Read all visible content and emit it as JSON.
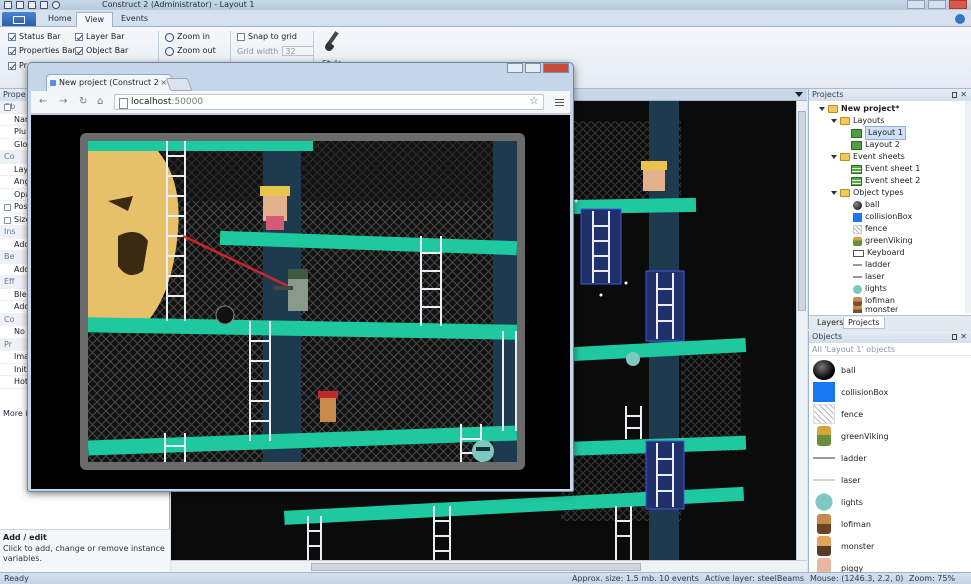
{
  "window": {
    "title": "Construct 2 (Administrator) - Layout 1"
  },
  "ribbon": {
    "tabs": [
      "Home",
      "View",
      "Events"
    ],
    "active_tab": "View",
    "view": {
      "status_bar": "Status Bar",
      "properties_bar": "Properties Bar",
      "project_bar_partial": "Pr",
      "layer_bar": "Layer Bar",
      "object_bar": "Object Bar",
      "zoom_in": "Zoom in",
      "zoom_out": "Zoom out",
      "snap_to_grid": "Snap to grid",
      "grid_width_label": "Grid width",
      "grid_width_value": "32",
      "style": "Style"
    }
  },
  "properties": {
    "title": "Prope",
    "rows": [
      "Ob",
      "Nam",
      "Plu",
      "Glo",
      "Co",
      "Lay",
      "Ang",
      "Opa",
      "Pos",
      "Size",
      "Ins",
      "Add",
      "Be",
      "Add",
      "Eff",
      "Blen",
      "Add",
      "Co",
      "No",
      "Pr",
      "Ima",
      "Init",
      "Hot"
    ],
    "more_info": "More in",
    "help_title": "Add / edit",
    "help_desc": "Click to add, change or remove instance variables."
  },
  "browser": {
    "tab_title": "New project (Construct 2",
    "tab_close": "×",
    "url_host": "localhost",
    "url_port": ":50000"
  },
  "projects": {
    "title": "Projects",
    "root": "New project*",
    "layouts_folder": "Layouts",
    "layouts": [
      "Layout 1",
      "Layout 2"
    ],
    "event_sheets_folder": "Event sheets",
    "event_sheets": [
      "Event sheet 1",
      "Event sheet 2"
    ],
    "object_types_folder": "Object types",
    "object_types": [
      {
        "name": "ball",
        "icon": "ball-icon"
      },
      {
        "name": "collisionBox",
        "icon": "collision-box-icon"
      },
      {
        "name": "fence",
        "icon": "fence-icon"
      },
      {
        "name": "greenViking",
        "icon": "viking-icon"
      },
      {
        "name": "Keyboard",
        "icon": "keyboard-icon"
      },
      {
        "name": "ladder",
        "icon": "ladder-icon"
      },
      {
        "name": "laser",
        "icon": "laser-icon"
      },
      {
        "name": "lights",
        "icon": "lights-icon"
      },
      {
        "name": "lofiman",
        "icon": "lofiman-icon"
      },
      {
        "name": "monster",
        "icon": "monster-icon"
      }
    ],
    "tabs": [
      "Layers",
      "Projects"
    ],
    "active_tab": "Projects"
  },
  "objects": {
    "title": "Objects",
    "filter": "All 'Layout 1' objects",
    "items": [
      "ball",
      "collisionBox",
      "fence",
      "greenViking",
      "ladder",
      "laser",
      "lights",
      "lofiman",
      "monster",
      "piggy"
    ]
  },
  "statusbar": {
    "ready": "Ready",
    "size": "Approx. size: 1.5 mb. 10 events",
    "layer": "Active layer: steelBeams",
    "mouse": "Mouse: (1246.3, 2.2, 0)",
    "zoom": "Zoom: 75%"
  },
  "colors": {
    "beam": "#1fc9a0",
    "pillar": "#1d3a4f",
    "ladder": "#e8eef2",
    "laser": "#e0242a",
    "selection": "#3b5bdb"
  }
}
